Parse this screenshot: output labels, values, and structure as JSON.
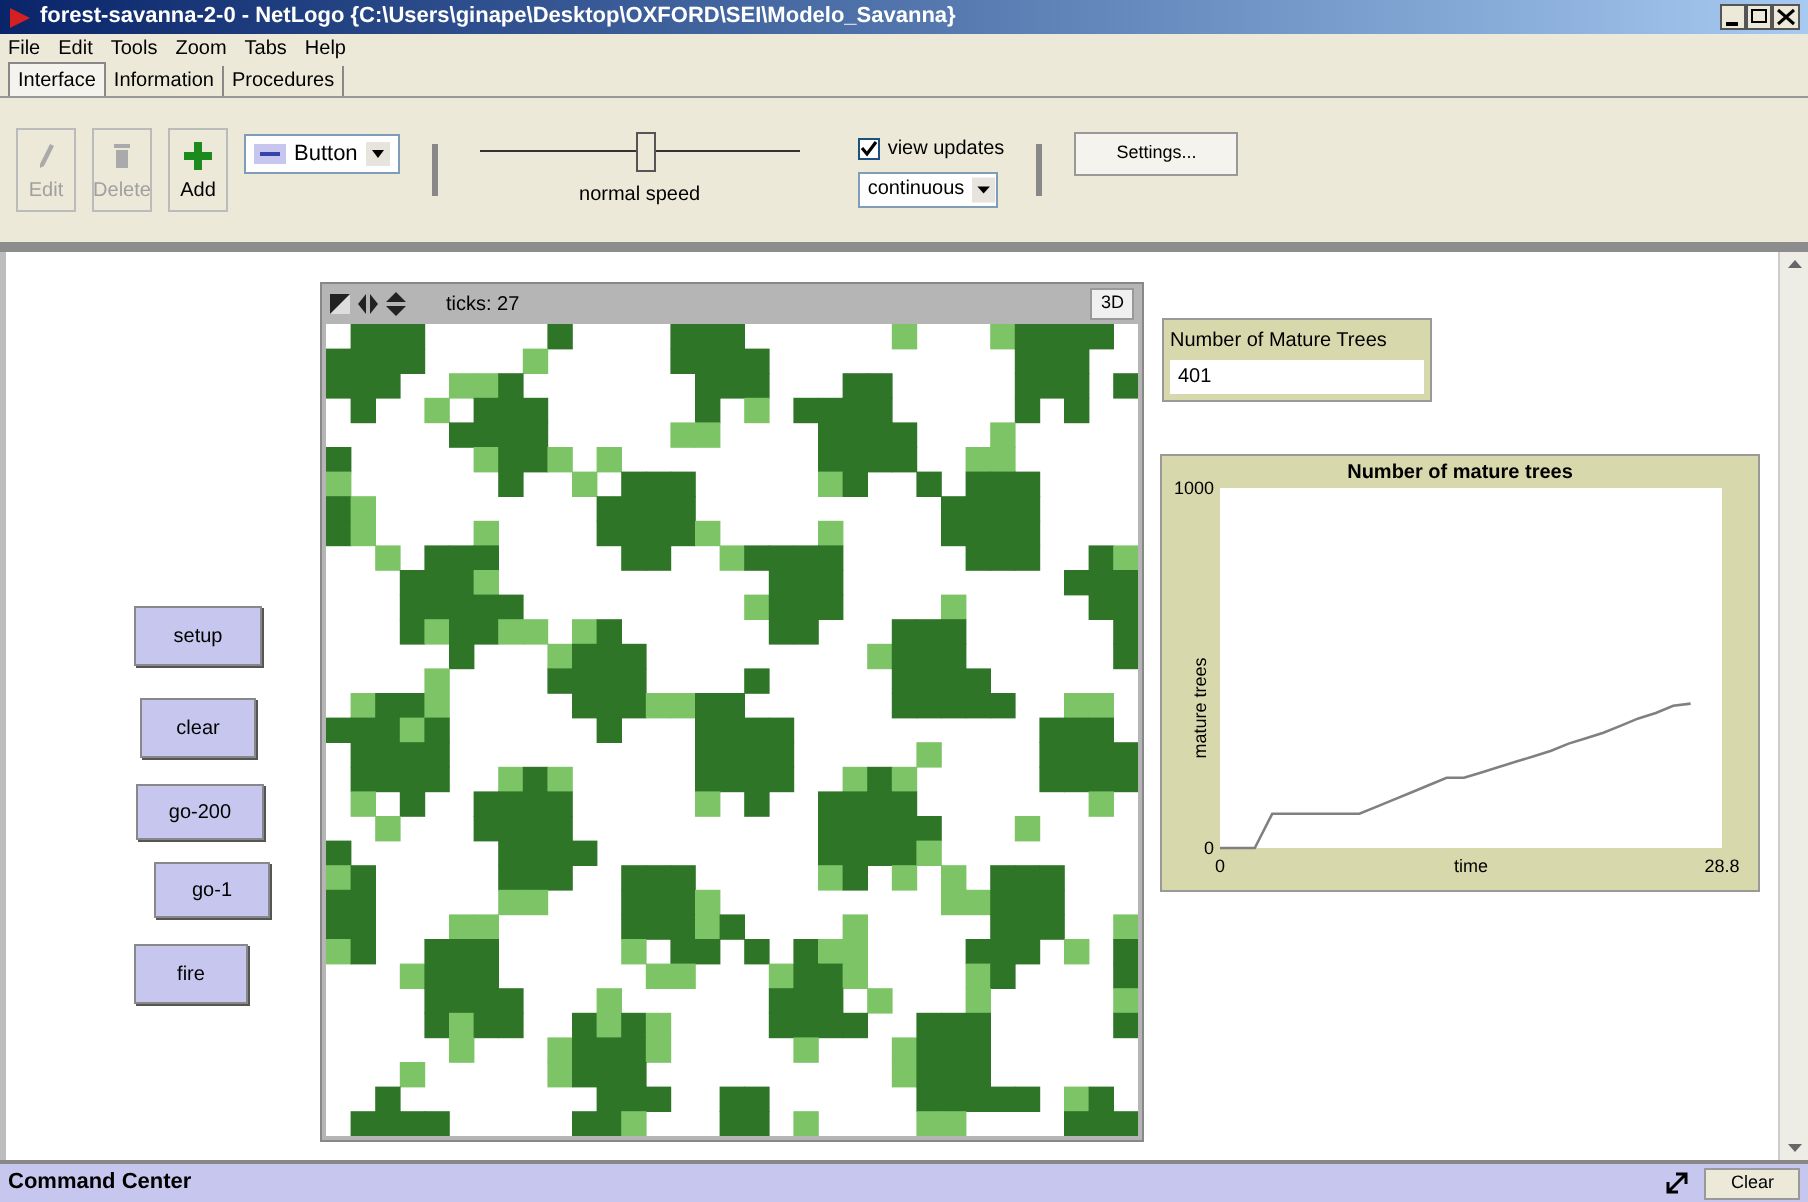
{
  "window": {
    "title": "forest-savanna-2-0 - NetLogo {C:\\Users\\ginape\\Desktop\\OXFORD\\SEI\\Modelo_Savanna}"
  },
  "menu": [
    "File",
    "Edit",
    "Tools",
    "Zoom",
    "Tabs",
    "Help"
  ],
  "tabs": [
    {
      "label": "Interface",
      "selected": true
    },
    {
      "label": "Information",
      "selected": false
    },
    {
      "label": "Procedures",
      "selected": false
    }
  ],
  "toolbar": {
    "edit": {
      "label": "Edit",
      "disabled": true
    },
    "delete": {
      "label": "Delete",
      "disabled": true
    },
    "add": {
      "label": "Add",
      "disabled": false
    },
    "widget_type": "Button",
    "speed": {
      "label": "normal speed",
      "level": 0.52
    },
    "view_updates": {
      "label": "view updates",
      "checked": true
    },
    "update_mode": "continuous",
    "settings": "Settings..."
  },
  "buttons": [
    "setup",
    "clear",
    "go-200",
    "go-1",
    "fire"
  ],
  "view": {
    "ticks": "ticks: 27",
    "three_d": "3D"
  },
  "monitor": {
    "label": "Number of Mature Trees",
    "value": "401"
  },
  "plot": {
    "chart_data": {
      "type": "line",
      "title": "Number of mature trees",
      "xlabel": "time",
      "ylabel": "mature trees",
      "xlim": [
        0,
        28.8
      ],
      "ylim": [
        0,
        1000
      ],
      "xticks": [
        0,
        28.8
      ],
      "yticks": [
        0,
        1000
      ],
      "x": [
        0,
        1,
        2,
        3,
        4,
        5,
        6,
        7,
        8,
        9,
        10,
        11,
        12,
        13,
        14,
        15,
        16,
        17,
        18,
        19,
        20,
        21,
        22,
        23,
        24,
        25,
        26,
        27
      ],
      "series": [
        {
          "color": "#808080",
          "values": [
            0,
            0,
            0,
            95,
            95,
            95,
            95,
            95,
            95,
            115,
            135,
            155,
            175,
            195,
            195,
            210,
            225,
            240,
            255,
            270,
            290,
            305,
            320,
            340,
            360,
            375,
            395,
            401
          ]
        }
      ]
    }
  },
  "command_center": {
    "title": "Command Center",
    "clear": "Clear"
  }
}
